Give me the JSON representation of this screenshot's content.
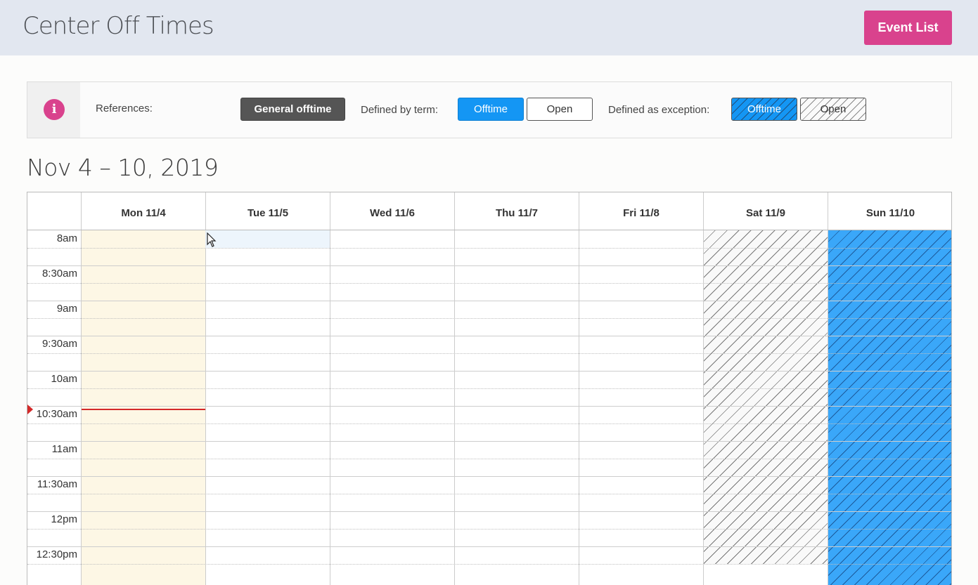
{
  "header": {
    "title": "Center Off Times",
    "event_list_label": "Event List"
  },
  "references": {
    "label": "References:",
    "general_offtime": "General offtime",
    "by_term_label": "Defined by term:",
    "by_term_offtime": "Offtime",
    "by_term_open": "Open",
    "by_exception_label": "Defined as exception:",
    "by_exception_offtime": "Offtime",
    "by_exception_open": "Open"
  },
  "calendar": {
    "range_title": "Nov 4 – 10, 2019",
    "days": [
      "Mon 11/4",
      "Tue 11/5",
      "Wed 11/6",
      "Thu 11/7",
      "Fri 11/8",
      "Sat 11/9",
      "Sun 11/10"
    ],
    "times": [
      "8am",
      "8:30am",
      "9am",
      "9:30am",
      "10am",
      "10:30am",
      "11am",
      "11:30am",
      "12pm",
      "12:30pm"
    ],
    "colors": {
      "today": "#fdf7e5",
      "term_offtime": "#1496f4",
      "now_indicator": "#d42929",
      "accent": "#d9428d"
    }
  }
}
